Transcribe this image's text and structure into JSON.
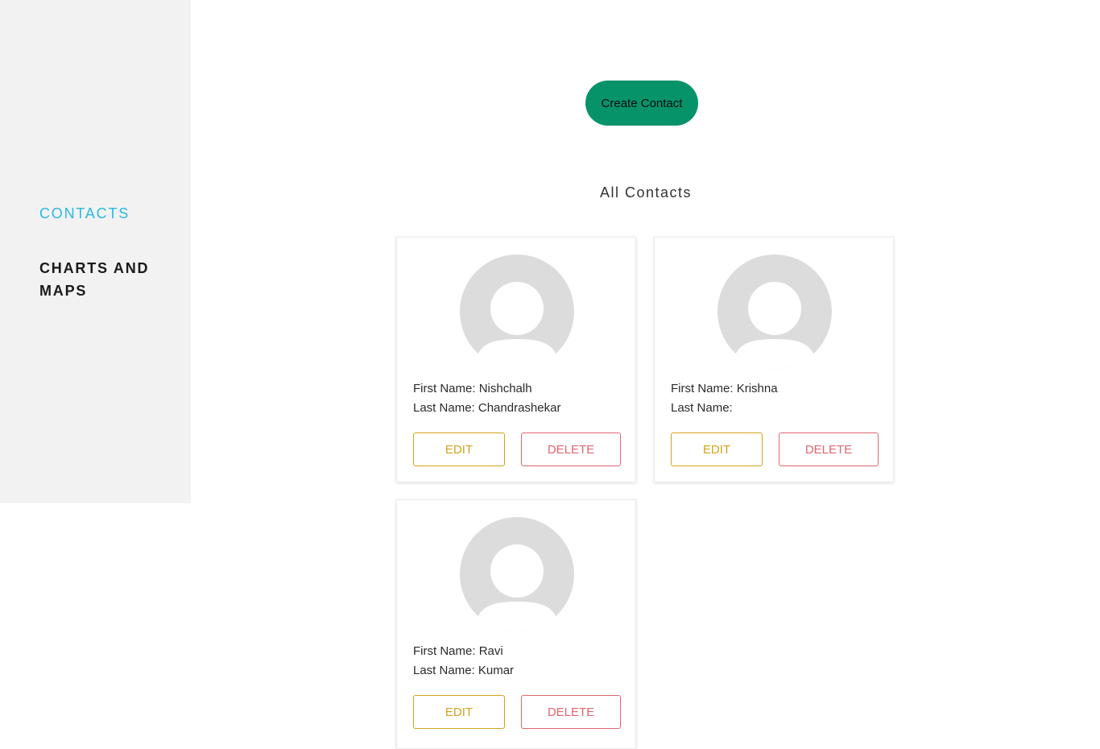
{
  "sidebar": {
    "items": [
      {
        "label": "CONTACTS",
        "active": true
      },
      {
        "label": "CHARTS AND MAPS",
        "active": false
      }
    ]
  },
  "main": {
    "create_button_label": "Create Contact",
    "section_title": "All Contacts",
    "field_labels": {
      "first_name": "First Name:",
      "last_name": "Last Name:"
    },
    "edit_label": "EDIT",
    "delete_label": "DELETE",
    "contacts": [
      {
        "first_name": "Nishchalh",
        "last_name": "Chandrashekar"
      },
      {
        "first_name": "Krishna",
        "last_name": ""
      },
      {
        "first_name": "Ravi",
        "last_name": "Kumar"
      }
    ]
  },
  "colors": {
    "sidebar_bg": "#f2f2f2",
    "nav_active": "#2bb8e3",
    "create_button_bg": "#07936a",
    "edit_accent": "#d4a21c",
    "delete_accent": "#e06670",
    "avatar_placeholder": "#dcdcdc"
  },
  "icons": {
    "avatar": "default-user-avatar-icon"
  }
}
